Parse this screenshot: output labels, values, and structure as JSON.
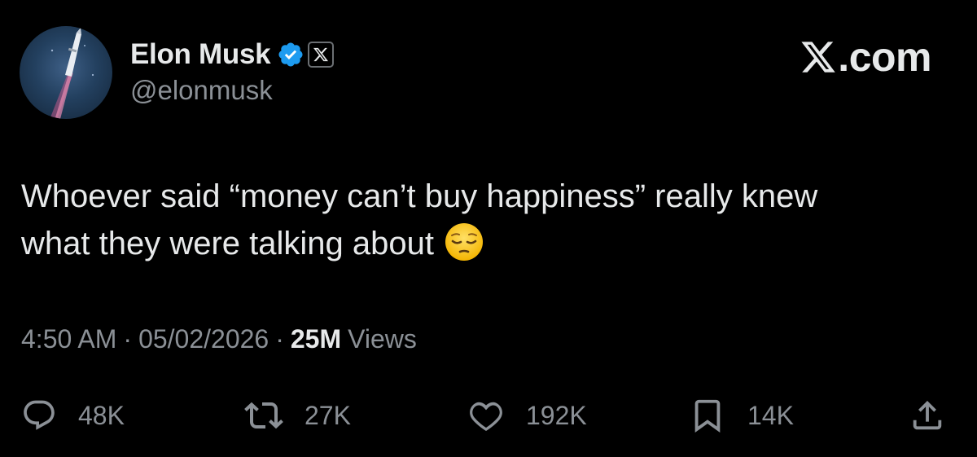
{
  "author": {
    "display_name": "Elon Musk",
    "handle": "@elonmusk",
    "verified_icon": "verified-badge-icon",
    "affiliation_icon": "x-logo-icon"
  },
  "brand": {
    "label": ".com",
    "icon": "x-logo-icon"
  },
  "post": {
    "text_line_1": "Whoever said “money can’t buy happiness” really knew",
    "text_line_2": "what they were talking about",
    "emoji": "pensive-face"
  },
  "meta": {
    "time": "4:50 AM",
    "separator": "·",
    "date": "05/02/2026",
    "views_count": "25M",
    "views_label": "Views"
  },
  "actions": {
    "replies": "48K",
    "reposts": "27K",
    "likes": "192K",
    "bookmarks": "14K"
  },
  "colors": {
    "background": "#000000",
    "primary_text": "#e7e9ea",
    "secondary_text": "#8b9096",
    "verified_blue": "#1d9bf0"
  }
}
